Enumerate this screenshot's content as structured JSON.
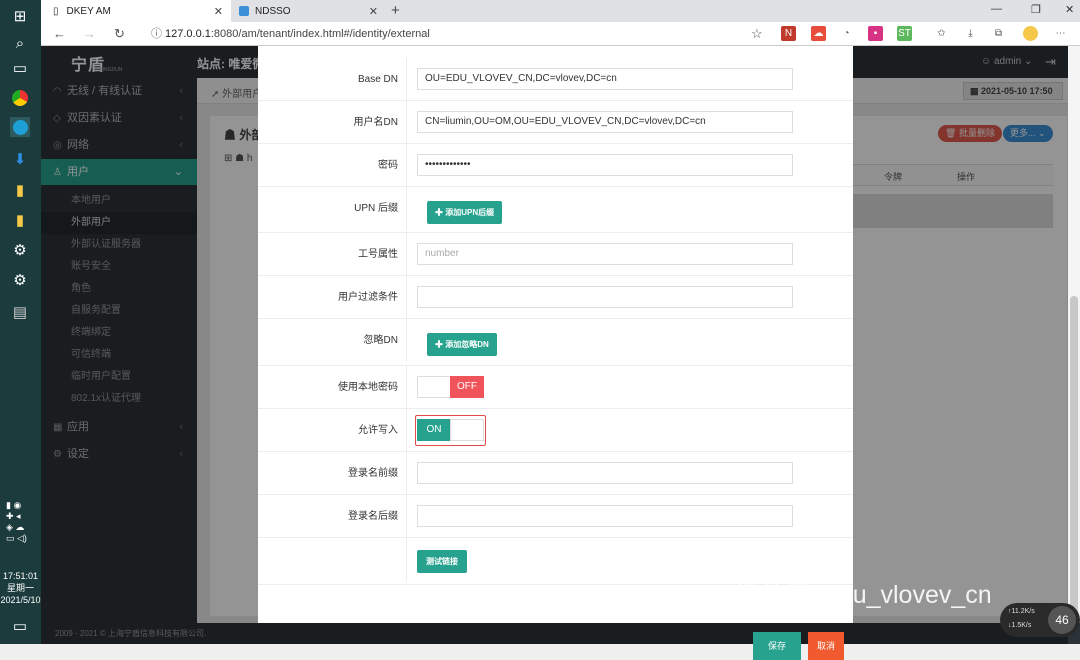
{
  "browser": {
    "tabs": [
      {
        "label": "DKEY AM",
        "active": true
      },
      {
        "label": "NDSSO",
        "active": false
      }
    ],
    "url_host": "127.0.0.1",
    "url_rest": ":8080/am/tenant/index.html#/identity/external"
  },
  "taskbar": {
    "time": "17:51:01",
    "weekday": "星期一",
    "date": "2021/5/10"
  },
  "header": {
    "logo": "宁盾",
    "logo_sub": "NINGDUN",
    "site": "站点: 唯爱微",
    "user": "admin"
  },
  "sidebar": {
    "items": [
      {
        "label": "无线 / 有线认证",
        "icon": "wifi-icon"
      },
      {
        "label": "双因素认证",
        "icon": "shield-icon"
      },
      {
        "label": "网络",
        "icon": "globe-icon"
      },
      {
        "label": "用户",
        "icon": "user-icon",
        "active": true
      },
      {
        "label": "应用",
        "icon": "grid-icon"
      },
      {
        "label": "设定",
        "icon": "gear-icon"
      }
    ],
    "sub_items": [
      {
        "label": "本地用户"
      },
      {
        "label": "外部用户",
        "current": true
      },
      {
        "label": "外部认证服务器"
      },
      {
        "label": "账号安全"
      },
      {
        "label": "角色"
      },
      {
        "label": "自服务配置"
      },
      {
        "label": "终端绑定"
      },
      {
        "label": "可信终端"
      },
      {
        "label": "临时用户配置"
      },
      {
        "label": "802.1x认证代理"
      }
    ]
  },
  "content": {
    "breadcrumb": "外部用户",
    "date": "2021-05-10 17:50",
    "panel_title": "外部",
    "batch_delete": "批量删除",
    "more": "更多...",
    "col_token": "令牌",
    "col_action": "操作"
  },
  "modal": {
    "rows": [
      {
        "label": "Base DN",
        "type": "input",
        "value": "OU=EDU_VLOVEV_CN,DC=vlovev,DC=cn"
      },
      {
        "label": "用户名DN",
        "type": "input",
        "value": "CN=liumin,OU=OM,OU=EDU_VLOVEV_CN,DC=vlovev,DC=cn"
      },
      {
        "label": "密码",
        "type": "input",
        "value": "•••••••••••••"
      },
      {
        "label": "UPN 后缀",
        "type": "button",
        "value": "✚ 添加UPN后缀"
      },
      {
        "label": "工号属性",
        "type": "input",
        "value": "",
        "placeholder": "number"
      },
      {
        "label": "用户过滤条件",
        "type": "input",
        "value": ""
      },
      {
        "label": "忽略DN",
        "type": "button",
        "value": "✚ 添加忽略DN"
      },
      {
        "label": "使用本地密码",
        "type": "toggle",
        "value": "OFF"
      },
      {
        "label": "允许写入",
        "type": "toggle",
        "value": "ON"
      },
      {
        "label": "登录名前缀",
        "type": "input",
        "value": ""
      },
      {
        "label": "登录名后缀",
        "type": "input",
        "value": ""
      },
      {
        "label": "",
        "type": "test",
        "value": "测试链接"
      }
    ],
    "save_label": "保存",
    "cancel_label": "取消"
  },
  "footer": "2009 - 2021 © 上海宁盾信息科技有限公司.",
  "watermark": "微信号: edu_vlovev_cn",
  "netmon": {
    "up": "11.2K/s",
    "down": "1.5K/s",
    "percent": "46"
  },
  "colors": {
    "accent": "#27a28e",
    "danger": "#e05a4e",
    "sidebar": "#2b3338"
  }
}
